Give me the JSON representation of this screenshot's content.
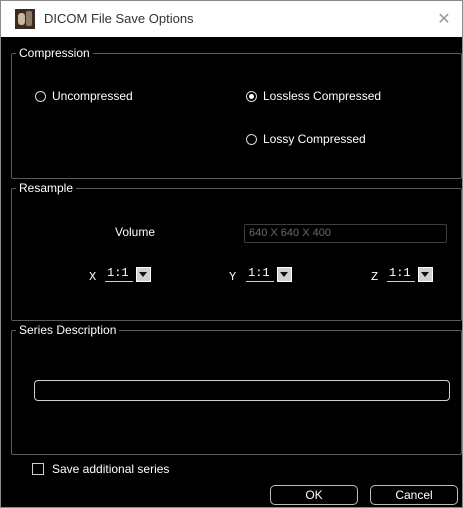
{
  "window": {
    "title": "DICOM File Save Options",
    "app_icon": "dicom-app-icon",
    "close_icon": "close-icon"
  },
  "compression": {
    "legend": "Compression",
    "options": [
      {
        "label": "Uncompressed",
        "selected": false
      },
      {
        "label": "Lossless Compressed",
        "selected": true
      },
      {
        "label": "Lossy Compressed",
        "selected": false
      }
    ]
  },
  "resample": {
    "legend": "Resample",
    "volume_label": "Volume",
    "volume_value": "640 X 640 X 400",
    "axes": [
      {
        "label": "X",
        "value": "1:1"
      },
      {
        "label": "Y",
        "value": "1:1"
      },
      {
        "label": "Z",
        "value": "1:1"
      }
    ]
  },
  "series": {
    "legend": "Series Description",
    "value": ""
  },
  "save_additional": {
    "label": "Save additional series",
    "checked": false
  },
  "buttons": {
    "ok": "OK",
    "cancel": "Cancel"
  },
  "colors": {
    "background": "#000000",
    "titlebar": "#ffffff",
    "group_border": "#5a5a5a"
  }
}
